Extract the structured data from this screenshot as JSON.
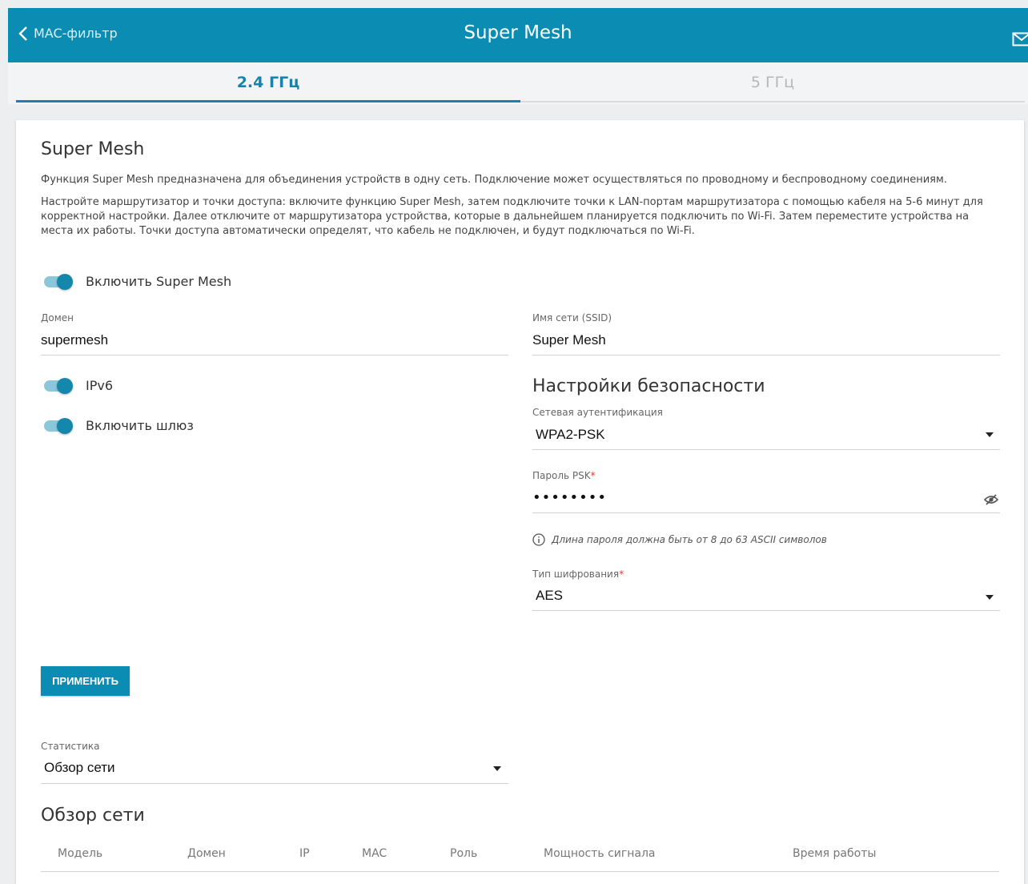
{
  "header": {
    "back_label": "MAC-фильтр",
    "title": "Super Mesh",
    "mail_icon": "mail-icon"
  },
  "tabs": [
    {
      "label": "2.4 ГГц",
      "active": true
    },
    {
      "label": "5 ГГц",
      "active": false
    }
  ],
  "main": {
    "heading": "Super Mesh",
    "desc1": "Функция Super Mesh предназначена для объединения устройств в одну сеть. Подключение может осуществляться по проводному и беспроводному соединениям.",
    "desc2": "Настройте маршрутизатор и точки доступа: включите функцию Super Mesh, затем подключите точки к LAN-портам маршрутизатора с помощью кабеля на 5-6 минут для корректной настройки. Далее отключите от маршрутизатора устройства, которые в дальнейшем планируется подключить по Wi-Fi. Затем переместите устройства на места их работы. Точки доступа автоматически определят, что кабель не подключен, и будут подключаться по Wi-Fi.",
    "enable_mesh_label": "Включить Super Mesh",
    "domain_label": "Домен",
    "domain_value": "supermesh",
    "ipv6_label": "IPv6",
    "gateway_label": "Включить шлюз",
    "ssid_label": "Имя сети (SSID)",
    "ssid_value": "Super Mesh",
    "security_heading": "Настройки безопасности",
    "auth_label": "Сетевая аутентификация",
    "auth_value": "WPA2-PSK",
    "psk_label": "Пароль PSK",
    "psk_required": "*",
    "psk_value": "••••••••",
    "psk_hint": "Длина пароля должна быть от 8 до 63 ASCII символов",
    "encryption_label": "Тип шифрования",
    "encryption_required": "*",
    "encryption_value": "AES",
    "apply_label": "ПРИМЕНИТЬ",
    "stats_label": "Статистика",
    "stats_value": "Обзор сети",
    "overview_heading": "Обзор сети"
  },
  "table": {
    "columns": [
      "Модель",
      "Домен",
      "IP",
      "MAC",
      "Роль",
      "Мощность сигнала",
      "Время работы"
    ]
  },
  "colors": {
    "accent": "#0b8db3",
    "toggle_on": "#1487ad",
    "required": "#e53935"
  }
}
